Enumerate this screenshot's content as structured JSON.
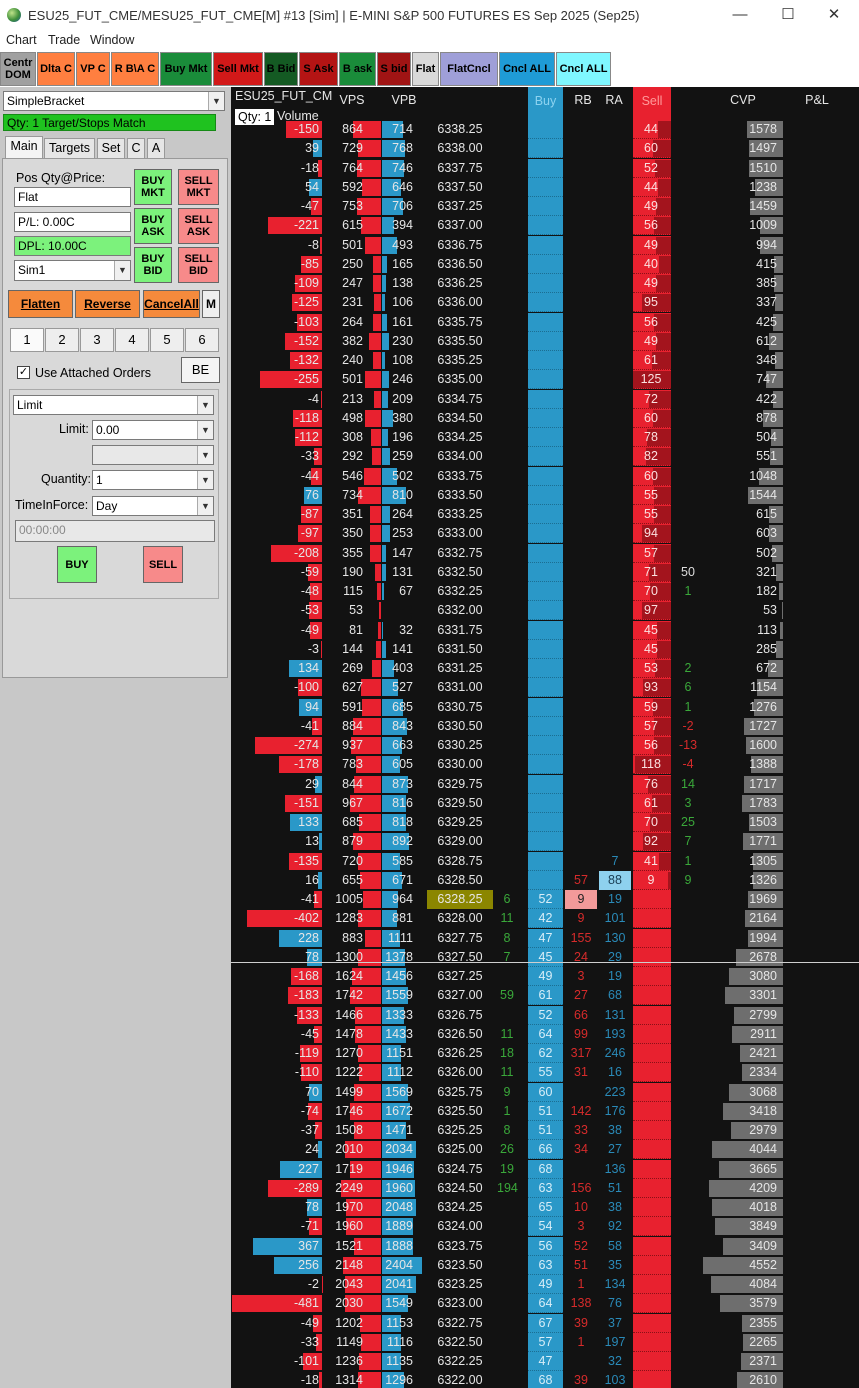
{
  "window": {
    "title": "ESU25_FUT_CME/MESU25_FUT_CME[M] #13 [Sim] | E-MINI S&P 500 FUTURES ES Sep 2025 (Sep25)",
    "minimize": "—",
    "maximize": "☐",
    "close": "✕"
  },
  "menu": [
    "Chart",
    "Trade",
    "Window"
  ],
  "toolbar": [
    {
      "label": "Centr DOM",
      "bg": "#a0a0a0",
      "fg": "#000"
    },
    {
      "label": "Dlta C",
      "bg": "#ff7f40",
      "fg": "#000"
    },
    {
      "label": "VP C",
      "bg": "#ff7f40",
      "fg": "#000"
    },
    {
      "label": "R B\\A C",
      "bg": "#ff7f40",
      "fg": "#000"
    },
    {
      "label": "Buy Mkt",
      "bg": "#1a8c3a",
      "fg": "#000"
    },
    {
      "label": "Sell Mkt",
      "bg": "#d21919",
      "fg": "#000"
    },
    {
      "label": "B Bid",
      "bg": "#145a23",
      "fg": "#000"
    },
    {
      "label": "S Ask",
      "bg": "#b41414",
      "fg": "#000"
    },
    {
      "label": "B ask",
      "bg": "#1a8c3a",
      "fg": "#000"
    },
    {
      "label": "S bid",
      "bg": "#a01414",
      "fg": "#000"
    },
    {
      "label": "Flat",
      "bg": "#d9d9d9",
      "fg": "#000"
    },
    {
      "label": "FlatCncl",
      "bg": "#9f9fd8",
      "fg": "#000"
    },
    {
      "label": "Cncl ALL",
      "bg": "#1f9bd6",
      "fg": "#000"
    },
    {
      "label": "Cncl ALL",
      "bg": "#7ff7ff",
      "fg": "#000"
    }
  ],
  "panel": {
    "strategy": "SimpleBracket",
    "status": "Qty: 1 Target/Stops Match",
    "tabs": [
      "Main",
      "Targets",
      "Set",
      "C",
      "A"
    ],
    "pos_label": "Pos Qty@Price:",
    "pos_value": "Flat",
    "pl": "P/L: 0.00C",
    "dpl": "DPL: 10.00C",
    "account": "Sim1",
    "buy_mkt": "BUY MKT",
    "sell_mkt": "SELL MKT",
    "buy_ask": "BUY ASK",
    "sell_ask": "SELL ASK",
    "buy_bid": "BUY BID",
    "sell_bid": "SELL BID",
    "flatten": "Flatten",
    "reverse": "Reverse",
    "cancelall": "CancelAll",
    "m": "M",
    "qty_buttons": [
      "1",
      "2",
      "3",
      "4",
      "5",
      "6"
    ],
    "use_attached": "Use Attached Orders",
    "be": "BE",
    "order_type": "Limit",
    "limit_label": "Limit:",
    "limit_value": "0.00",
    "quantity_label": "Quantity:",
    "quantity_value": "1",
    "tif_label": "TimeInForce:",
    "tif_value": "Day",
    "time_value": "00:00:00",
    "buy": "BUY",
    "sell": "SELL"
  },
  "ladder": {
    "symbol": "ESU25_FUT_CM",
    "qty_label": "Qty: 1",
    "volume_label": "Volume",
    "headers": {
      "vps": "VPS",
      "vpb": "VPB",
      "buy": "Buy",
      "rb": "RB",
      "ra": "RA",
      "sell": "Sell",
      "cvp": "CVP",
      "pl": "P&L"
    },
    "colors": {
      "blue": "#2a98c8",
      "red": "#e8212f",
      "gray": "#6e6e6e",
      "inside": "#8b8600"
    },
    "rows": [
      {
        "d": "-150",
        "vps": "864",
        "vpb": "714",
        "p": "6338.25",
        "buy": "",
        "rb": "",
        "ra": "",
        "sell": "44",
        "x": "",
        "cvp": "1578"
      },
      {
        "d": "39",
        "vps": "729",
        "vpb": "768",
        "p": "6338.00",
        "buy": "",
        "rb": "",
        "ra": "",
        "sell": "60",
        "x": "",
        "cvp": "1497"
      },
      {
        "d": "-18",
        "vps": "764",
        "vpb": "746",
        "p": "6337.75",
        "buy": "",
        "rb": "",
        "ra": "",
        "sell": "52",
        "x": "",
        "cvp": "1510"
      },
      {
        "d": "54",
        "vps": "592",
        "vpb": "646",
        "p": "6337.50",
        "buy": "",
        "rb": "",
        "ra": "",
        "sell": "44",
        "x": "",
        "cvp": "1238"
      },
      {
        "d": "-47",
        "vps": "753",
        "vpb": "706",
        "p": "6337.25",
        "buy": "",
        "rb": "",
        "ra": "",
        "sell": "49",
        "x": "",
        "cvp": "1459"
      },
      {
        "d": "-221",
        "vps": "615",
        "vpb": "394",
        "p": "6337.00",
        "buy": "",
        "rb": "",
        "ra": "",
        "sell": "56",
        "x": "",
        "cvp": "1009"
      },
      {
        "d": "-8",
        "vps": "501",
        "vpb": "493",
        "p": "6336.75",
        "buy": "",
        "rb": "",
        "ra": "",
        "sell": "49",
        "x": "",
        "cvp": "994"
      },
      {
        "d": "-85",
        "vps": "250",
        "vpb": "165",
        "p": "6336.50",
        "buy": "",
        "rb": "",
        "ra": "",
        "sell": "40",
        "x": "",
        "cvp": "415"
      },
      {
        "d": "-109",
        "vps": "247",
        "vpb": "138",
        "p": "6336.25",
        "buy": "",
        "rb": "",
        "ra": "",
        "sell": "49",
        "x": "",
        "cvp": "385"
      },
      {
        "d": "-125",
        "vps": "231",
        "vpb": "106",
        "p": "6336.00",
        "buy": "",
        "rb": "",
        "ra": "",
        "sell": "95",
        "x": "",
        "cvp": "337"
      },
      {
        "d": "-103",
        "vps": "264",
        "vpb": "161",
        "p": "6335.75",
        "buy": "",
        "rb": "",
        "ra": "",
        "sell": "56",
        "x": "",
        "cvp": "425"
      },
      {
        "d": "-152",
        "vps": "382",
        "vpb": "230",
        "p": "6335.50",
        "buy": "",
        "rb": "",
        "ra": "",
        "sell": "49",
        "x": "",
        "cvp": "612"
      },
      {
        "d": "-132",
        "vps": "240",
        "vpb": "108",
        "p": "6335.25",
        "buy": "",
        "rb": "",
        "ra": "",
        "sell": "61",
        "x": "",
        "cvp": "348"
      },
      {
        "d": "-255",
        "vps": "501",
        "vpb": "246",
        "p": "6335.00",
        "buy": "",
        "rb": "",
        "ra": "",
        "sell": "125",
        "x": "",
        "cvp": "747"
      },
      {
        "d": "-4",
        "vps": "213",
        "vpb": "209",
        "p": "6334.75",
        "buy": "",
        "rb": "",
        "ra": "",
        "sell": "72",
        "x": "",
        "cvp": "422"
      },
      {
        "d": "-118",
        "vps": "498",
        "vpb": "380",
        "p": "6334.50",
        "buy": "",
        "rb": "",
        "ra": "",
        "sell": "60",
        "x": "",
        "cvp": "878"
      },
      {
        "d": "-112",
        "vps": "308",
        "vpb": "196",
        "p": "6334.25",
        "buy": "",
        "rb": "",
        "ra": "",
        "sell": "78",
        "x": "",
        "cvp": "504"
      },
      {
        "d": "-33",
        "vps": "292",
        "vpb": "259",
        "p": "6334.00",
        "buy": "",
        "rb": "",
        "ra": "",
        "sell": "82",
        "x": "",
        "cvp": "551"
      },
      {
        "d": "-44",
        "vps": "546",
        "vpb": "502",
        "p": "6333.75",
        "buy": "",
        "rb": "",
        "ra": "",
        "sell": "60",
        "x": "",
        "cvp": "1048"
      },
      {
        "d": "76",
        "vps": "734",
        "vpb": "810",
        "p": "6333.50",
        "buy": "",
        "rb": "",
        "ra": "",
        "sell": "55",
        "x": "",
        "cvp": "1544"
      },
      {
        "d": "-87",
        "vps": "351",
        "vpb": "264",
        "p": "6333.25",
        "buy": "",
        "rb": "",
        "ra": "",
        "sell": "55",
        "x": "",
        "cvp": "615"
      },
      {
        "d": "-97",
        "vps": "350",
        "vpb": "253",
        "p": "6333.00",
        "buy": "",
        "rb": "",
        "ra": "",
        "sell": "94",
        "x": "",
        "cvp": "603"
      },
      {
        "d": "-208",
        "vps": "355",
        "vpb": "147",
        "p": "6332.75",
        "buy": "",
        "rb": "",
        "ra": "",
        "sell": "57",
        "x": "",
        "cvp": "502"
      },
      {
        "d": "-59",
        "vps": "190",
        "vpb": "131",
        "p": "6332.50",
        "buy": "",
        "rb": "",
        "ra": "",
        "sell": "71",
        "x": "50",
        "cvp": "321"
      },
      {
        "d": "-48",
        "vps": "115",
        "vpb": "67",
        "p": "6332.25",
        "buy": "",
        "rb": "",
        "ra": "",
        "sell": "70",
        "x": "1",
        "cvp": "182"
      },
      {
        "d": "-53",
        "vps": "53",
        "vpb": "",
        "p": "6332.00",
        "buy": "",
        "rb": "",
        "ra": "",
        "sell": "97",
        "x": "",
        "cvp": "53"
      },
      {
        "d": "-49",
        "vps": "81",
        "vpb": "32",
        "p": "6331.75",
        "buy": "",
        "rb": "",
        "ra": "",
        "sell": "45",
        "x": "",
        "cvp": "113"
      },
      {
        "d": "-3",
        "vps": "144",
        "vpb": "141",
        "p": "6331.50",
        "buy": "",
        "rb": "",
        "ra": "",
        "sell": "45",
        "x": "",
        "cvp": "285"
      },
      {
        "d": "134",
        "vps": "269",
        "vpb": "403",
        "p": "6331.25",
        "buy": "",
        "rb": "",
        "ra": "",
        "sell": "53",
        "x": "2",
        "cvp": "672"
      },
      {
        "d": "-100",
        "vps": "627",
        "vpb": "527",
        "p": "6331.00",
        "buy": "",
        "rb": "",
        "ra": "",
        "sell": "93",
        "x": "6",
        "cvp": "1154"
      },
      {
        "d": "94",
        "vps": "591",
        "vpb": "685",
        "p": "6330.75",
        "buy": "",
        "rb": "",
        "ra": "",
        "sell": "59",
        "x": "1",
        "cvp": "1276"
      },
      {
        "d": "-41",
        "vps": "884",
        "vpb": "843",
        "p": "6330.50",
        "buy": "",
        "rb": "",
        "ra": "",
        "sell": "57",
        "x": "-2",
        "cvp": "1727"
      },
      {
        "d": "-274",
        "vps": "937",
        "vpb": "663",
        "p": "6330.25",
        "buy": "",
        "rb": "",
        "ra": "",
        "sell": "56",
        "x": "-13",
        "cvp": "1600"
      },
      {
        "d": "-178",
        "vps": "783",
        "vpb": "605",
        "p": "6330.00",
        "buy": "",
        "rb": "",
        "ra": "",
        "sell": "118",
        "x": "-4",
        "cvp": "1388"
      },
      {
        "d": "29",
        "vps": "844",
        "vpb": "873",
        "p": "6329.75",
        "buy": "",
        "rb": "",
        "ra": "",
        "sell": "76",
        "x": "14",
        "cvp": "1717"
      },
      {
        "d": "-151",
        "vps": "967",
        "vpb": "816",
        "p": "6329.50",
        "buy": "",
        "rb": "",
        "ra": "",
        "sell": "61",
        "x": "3",
        "cvp": "1783"
      },
      {
        "d": "133",
        "vps": "685",
        "vpb": "818",
        "p": "6329.25",
        "buy": "",
        "rb": "",
        "ra": "",
        "sell": "70",
        "x": "25",
        "cvp": "1503"
      },
      {
        "d": "13",
        "vps": "879",
        "vpb": "892",
        "p": "6329.00",
        "buy": "",
        "rb": "",
        "ra": "",
        "sell": "92",
        "x": "7",
        "cvp": "1771"
      },
      {
        "d": "-135",
        "vps": "720",
        "vpb": "585",
        "p": "6328.75",
        "buy": "",
        "rb": "",
        "ra": "7",
        "sell": "41",
        "x": "1",
        "cvp": "1305"
      },
      {
        "d": "16",
        "vps": "655",
        "vpb": "671",
        "p": "6328.50",
        "buy": "",
        "rb": "57",
        "ra": "88",
        "sell": "9",
        "x": "9",
        "cvp": "1326"
      },
      {
        "d": "-41",
        "vps": "1005",
        "vpb": "964",
        "p": "6328.25",
        "x2": "6",
        "buy": "52",
        "rb": "9",
        "ra": "19",
        "sell": "",
        "x": "",
        "cvp": "1969"
      },
      {
        "d": "-402",
        "vps": "1283",
        "vpb": "881",
        "p": "6328.00",
        "x2": "11",
        "buy": "42",
        "rb": "9",
        "ra": "101",
        "sell": "",
        "x": "",
        "cvp": "2164"
      },
      {
        "d": "228",
        "vps": "883",
        "vpb": "1111",
        "p": "6327.75",
        "x2": "8",
        "buy": "47",
        "rb": "155",
        "ra": "130",
        "sell": "",
        "x": "",
        "cvp": "1994"
      },
      {
        "d": "78",
        "vps": "1300",
        "vpb": "1378",
        "p": "6327.50",
        "x2": "7",
        "buy": "45",
        "rb": "24",
        "ra": "29",
        "sell": "",
        "x": "",
        "cvp": "2678"
      },
      {
        "d": "-168",
        "vps": "1624",
        "vpb": "1456",
        "p": "6327.25",
        "x2": "",
        "buy": "49",
        "rb": "3",
        "ra": "19",
        "sell": "",
        "x": "",
        "cvp": "3080"
      },
      {
        "d": "-183",
        "vps": "1742",
        "vpb": "1559",
        "p": "6327.00",
        "x2": "59",
        "buy": "61",
        "rb": "27",
        "ra": "68",
        "sell": "",
        "x": "",
        "cvp": "3301"
      },
      {
        "d": "-133",
        "vps": "1466",
        "vpb": "1333",
        "p": "6326.75",
        "x2": "",
        "buy": "52",
        "rb": "66",
        "ra": "131",
        "sell": "",
        "x": "",
        "cvp": "2799"
      },
      {
        "d": "-45",
        "vps": "1478",
        "vpb": "1433",
        "p": "6326.50",
        "x2": "11",
        "buy": "64",
        "rb": "99",
        "ra": "193",
        "sell": "",
        "x": "",
        "cvp": "2911"
      },
      {
        "d": "-119",
        "vps": "1270",
        "vpb": "1151",
        "p": "6326.25",
        "x2": "18",
        "buy": "62",
        "rb": "317",
        "ra": "246",
        "sell": "",
        "x": "",
        "cvp": "2421"
      },
      {
        "d": "-110",
        "vps": "1222",
        "vpb": "1112",
        "p": "6326.00",
        "x2": "11",
        "buy": "55",
        "rb": "31",
        "ra": "16",
        "sell": "",
        "x": "",
        "cvp": "2334"
      },
      {
        "d": "70",
        "vps": "1499",
        "vpb": "1569",
        "p": "6325.75",
        "x2": "9",
        "buy": "60",
        "rb": "",
        "ra": "223",
        "sell": "",
        "x": "",
        "cvp": "3068"
      },
      {
        "d": "-74",
        "vps": "1746",
        "vpb": "1672",
        "p": "6325.50",
        "x2": "1",
        "buy": "51",
        "rb": "142",
        "ra": "176",
        "sell": "",
        "x": "",
        "cvp": "3418"
      },
      {
        "d": "-37",
        "vps": "1508",
        "vpb": "1471",
        "p": "6325.25",
        "x2": "8",
        "buy": "51",
        "rb": "33",
        "ra": "38",
        "sell": "",
        "x": "",
        "cvp": "2979"
      },
      {
        "d": "24",
        "vps": "2010",
        "vpb": "2034",
        "p": "6325.00",
        "x2": "26",
        "buy": "66",
        "rb": "34",
        "ra": "27",
        "sell": "",
        "x": "",
        "cvp": "4044"
      },
      {
        "d": "227",
        "vps": "1719",
        "vpb": "1946",
        "p": "6324.75",
        "x2": "19",
        "buy": "68",
        "rb": "",
        "ra": "136",
        "sell": "",
        "x": "",
        "cvp": "3665"
      },
      {
        "d": "-289",
        "vps": "2249",
        "vpb": "1960",
        "p": "6324.50",
        "x2": "194",
        "buy": "63",
        "rb": "156",
        "ra": "51",
        "sell": "",
        "x": "",
        "cvp": "4209"
      },
      {
        "d": "78",
        "vps": "1970",
        "vpb": "2048",
        "p": "6324.25",
        "x2": "",
        "buy": "65",
        "rb": "10",
        "ra": "38",
        "sell": "",
        "x": "",
        "cvp": "4018"
      },
      {
        "d": "-71",
        "vps": "1960",
        "vpb": "1889",
        "p": "6324.00",
        "x2": "",
        "buy": "54",
        "rb": "3",
        "ra": "92",
        "sell": "",
        "x": "",
        "cvp": "3849"
      },
      {
        "d": "367",
        "vps": "1521",
        "vpb": "1888",
        "p": "6323.75",
        "x2": "",
        "buy": "56",
        "rb": "52",
        "ra": "58",
        "sell": "",
        "x": "",
        "cvp": "3409"
      },
      {
        "d": "256",
        "vps": "2148",
        "vpb": "2404",
        "p": "6323.50",
        "x2": "",
        "buy": "63",
        "rb": "51",
        "ra": "35",
        "sell": "",
        "x": "",
        "cvp": "4552"
      },
      {
        "d": "-2",
        "vps": "2043",
        "vpb": "2041",
        "p": "6323.25",
        "x2": "",
        "buy": "49",
        "rb": "1",
        "ra": "134",
        "sell": "",
        "x": "",
        "cvp": "4084"
      },
      {
        "d": "-481",
        "vps": "2030",
        "vpb": "1549",
        "p": "6323.00",
        "x2": "",
        "buy": "64",
        "rb": "138",
        "ra": "76",
        "sell": "",
        "x": "",
        "cvp": "3579"
      },
      {
        "d": "-49",
        "vps": "1202",
        "vpb": "1153",
        "p": "6322.75",
        "x2": "",
        "buy": "67",
        "rb": "39",
        "ra": "37",
        "sell": "",
        "x": "",
        "cvp": "2355"
      },
      {
        "d": "-33",
        "vps": "1149",
        "vpb": "1116",
        "p": "6322.50",
        "x2": "",
        "buy": "57",
        "rb": "1",
        "ra": "197",
        "sell": "",
        "x": "",
        "cvp": "2265"
      },
      {
        "d": "-101",
        "vps": "1236",
        "vpb": "1135",
        "p": "6322.25",
        "x2": "",
        "buy": "47",
        "rb": "",
        "ra": "32",
        "sell": "",
        "x": "",
        "cvp": "2371"
      },
      {
        "d": "-18",
        "vps": "1314",
        "vpb": "1296",
        "p": "6322.00",
        "x2": "",
        "buy": "68",
        "rb": "39",
        "ra": "103",
        "sell": "",
        "x": "",
        "cvp": "2610"
      }
    ]
  }
}
